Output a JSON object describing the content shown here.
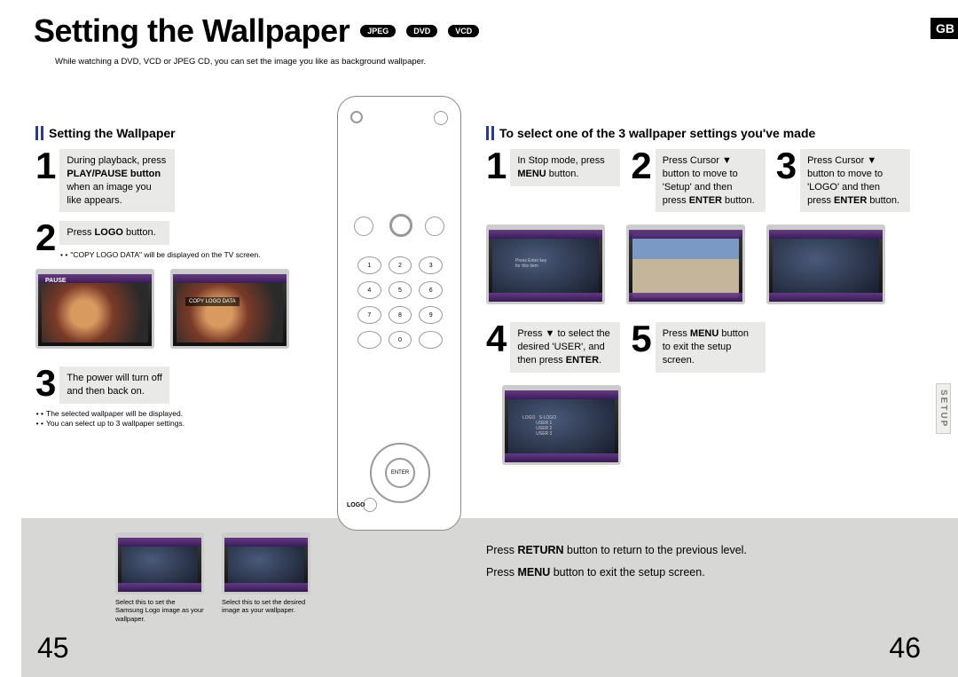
{
  "header": {
    "title": "Setting the Wallpaper",
    "pills": [
      "JPEG",
      "DVD",
      "VCD"
    ],
    "subtitle": "While watching a DVD, VCD or JPEG CD, you can set the image you like as background wallpaper.",
    "gb": "GB"
  },
  "left_section": {
    "heading": "Setting the Wallpaper",
    "steps": {
      "s1": "During playback, press <b>PLAY/PAUSE button</b> when an image you like appears.",
      "s2": "Press <b>LOGO</b> button.",
      "s2_note": "\"COPY LOGO DATA\" will be displayed on the TV screen.",
      "s3": "The power will turn off and then back on.",
      "s3_notes": [
        "The selected wallpaper will be displayed.",
        "You can select up to 3 wallpaper settings."
      ]
    },
    "tv_labels": {
      "pause": "PAUSE",
      "copy": "COPY LOGO DATA"
    }
  },
  "right_section": {
    "heading": "To select one of the 3 wallpaper settings you've made",
    "steps": {
      "s1": "In Stop mode, press <b>MENU</b> button.",
      "s2": "Press Cursor ▼ button to move to 'Setup' and then press <b>ENTER</b> button.",
      "s3": "Press Cursor ▼ button to move to 'LOGO' and then press <b>ENTER</b> button.",
      "s4": "Press ▼ to select the desired 'USER', and then press <b>ENTER</b>.",
      "s5": "Press <b>MENU</b> button to exit the setup screen."
    }
  },
  "bottom": {
    "thumb_captions": [
      "Select this to set the Samsung Logo image as your wallpaper.",
      "Select this to set the desired image as your wallpaper."
    ],
    "lines": [
      "Press <b>RETURN</b> button to return to the previous level.",
      "Press <b>MENU</b> button to exit the setup screen."
    ]
  },
  "side_tab": "SETUP",
  "page_numbers": {
    "left": "45",
    "right": "46"
  },
  "remote": {
    "numbers": [
      "1",
      "2",
      "3",
      "4",
      "5",
      "6",
      "7",
      "8",
      "9",
      "",
      "0",
      ""
    ],
    "logo": "LOGO"
  }
}
